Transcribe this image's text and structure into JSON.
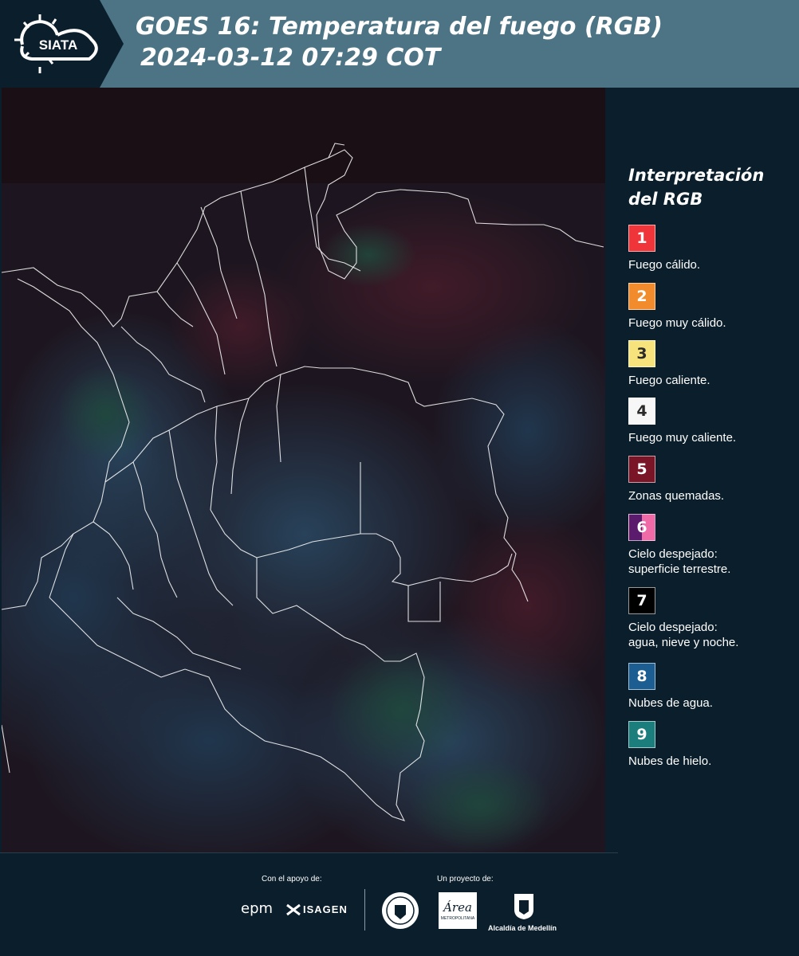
{
  "header": {
    "logo_text": "SIATA",
    "title_line1": "GOES 16: Temperatura del fuego (RGB)",
    "title_line2": "2024-03-12 07:29 COT",
    "accent_color": "#4c7485"
  },
  "legend": {
    "title_line1": "Interpretación",
    "title_line2": "del RGB",
    "items": [
      {
        "number": "1",
        "label_lines": [
          "Fuego cálido."
        ],
        "color": "#f0353a"
      },
      {
        "number": "2",
        "label_lines": [
          "Fuego muy cálido."
        ],
        "color": "#f28b2c"
      },
      {
        "number": "3",
        "label_lines": [
          "Fuego caliente."
        ],
        "color": "#f7e37c"
      },
      {
        "number": "4",
        "label_lines": [
          "Fuego muy caliente."
        ],
        "color": "#f7f7f7"
      },
      {
        "number": "5",
        "label_lines": [
          "Zonas quemadas."
        ],
        "color": "#7a1427"
      },
      {
        "number": "6",
        "label_lines": [
          "Cielo despejado:",
          "superficie terrestre."
        ],
        "color": "#5c1c6e",
        "color2": "#f06aa8"
      },
      {
        "number": "7",
        "label_lines": [
          "Cielo despejado:",
          "agua, nieve y noche."
        ],
        "color": "#000000"
      },
      {
        "number": "8",
        "label_lines": [
          "Nubes de agua."
        ],
        "color": "#1c5e92"
      },
      {
        "number": "9",
        "label_lines": [
          "Nubes de hielo."
        ],
        "color": "#1c7d7d"
      }
    ]
  },
  "map": {
    "background_color": "#1d1620"
  },
  "footer": {
    "support_label": "Con el apoyo de:",
    "project_label": "Un proyecto de:",
    "epm_text": "epm",
    "isagen_text": "ISAGEN",
    "area_text": "Área",
    "area_subtext": "METROPOLITANA",
    "alcaldia_text": "Alcaldía de Medellín"
  }
}
